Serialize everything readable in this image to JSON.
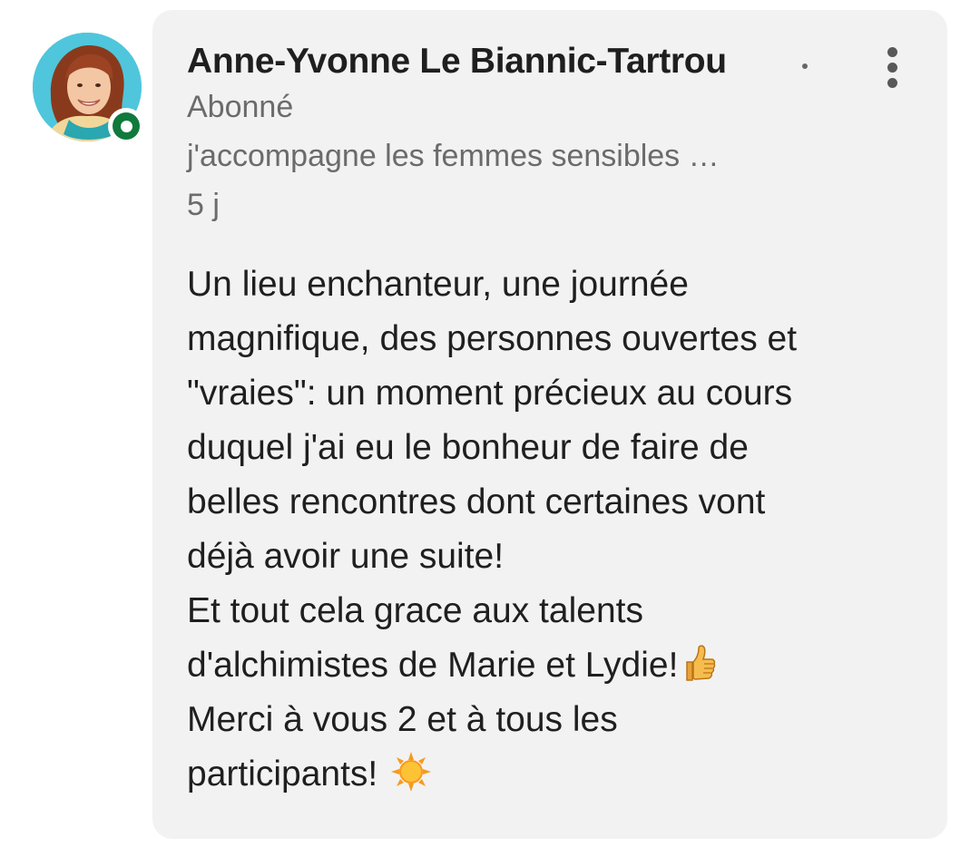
{
  "comment": {
    "author_name": "Anne-Yvonne Le Biannic-Tartrou",
    "relation": "Abonné",
    "headline": "j'accompagne les femmes sensibles …",
    "time_ago": "5 j",
    "text_lines": [
      "Un lieu enchanteur, une journée",
      "magnifique, des personnes ouvertes et",
      "\"vraies\": un moment précieux au cours",
      "duquel j'ai eu le bonheur de faire de",
      "belles rencontres dont certaines vont",
      "déjà avoir une suite!",
      "Et tout cela grace aux talents",
      "d'alchimistes de Marie et Lydie!",
      "Merci à vous 2 et à tous les",
      "participants!"
    ],
    "emoji_after_line_8": "thumbs-up-icon",
    "emoji_after_line_10": "sun-icon"
  },
  "avatar": {
    "presence_status": "online",
    "presence_color": "#0f7a3c"
  },
  "colors": {
    "bubble_background": "#f2f2f2",
    "primary_text": "#1f1f1f",
    "secondary_text": "#6b6b6b"
  }
}
